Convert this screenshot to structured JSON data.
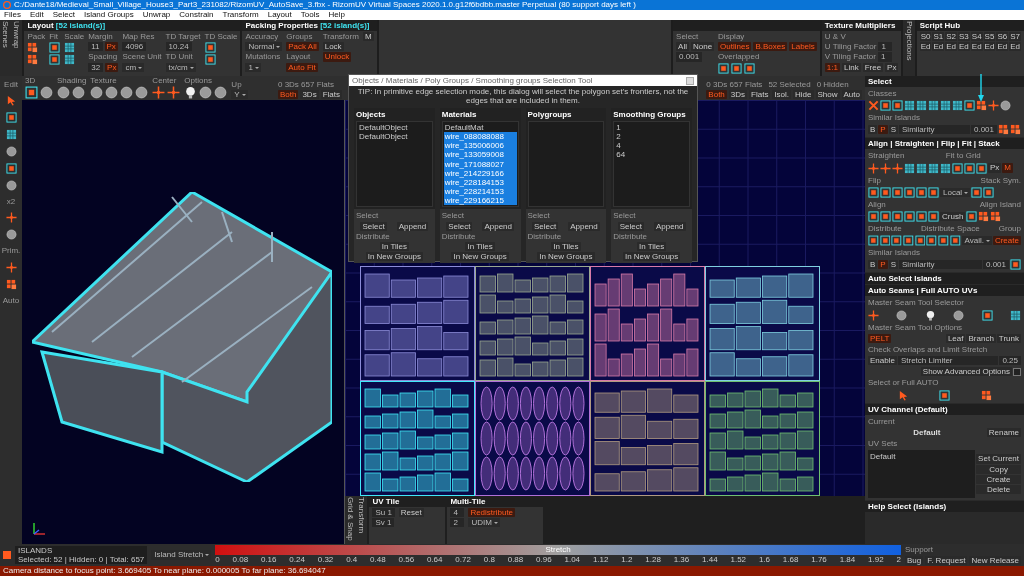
{
  "window": {
    "title": "C:/Dante18/Medieval_Small_Village_House3_Part3_231082/RizomUV_AutoSave_3.fbx - RizomUV  Virtual Spaces 2020.1.0.g12f6bdbb.master Perpetual  (80 support days left )"
  },
  "menu": [
    "Files",
    "Edit",
    "Select",
    "Island Groups",
    "Unwrap",
    "Constrain",
    "Transform",
    "Layout",
    "Tools",
    "Help"
  ],
  "side_tabs": [
    "Scenes",
    "Unwrap"
  ],
  "top_panels": [
    {
      "title": "Layout",
      "highlight": "[52 island(s)]",
      "cols": [
        {
          "items": [
            {
              "kind": "label",
              "text": "Pack"
            },
            {
              "kind": "blocks"
            },
            {
              "kind": "blocks"
            }
          ]
        },
        {
          "items": [
            {
              "kind": "label",
              "text": "Fit"
            },
            {
              "kind": "frame"
            },
            {
              "kind": "frame"
            }
          ]
        },
        {
          "items": [
            {
              "kind": "label",
              "text": "Scale"
            },
            {
              "kind": "grid"
            },
            {
              "kind": "grid"
            }
          ]
        },
        {
          "items": [
            {
              "kind": "label",
              "text": "Margin"
            },
            {
              "kind": "row",
              "items": [
                {
                  "kind": "field",
                  "text": "11"
                },
                {
                  "kind": "button",
                  "text": "Px",
                  "on": true
                }
              ]
            },
            {
              "kind": "label",
              "text": "Spacing"
            },
            {
              "kind": "row",
              "items": [
                {
                  "kind": "field",
                  "text": "32"
                },
                {
                  "kind": "button",
                  "text": "Px",
                  "on": true
                }
              ]
            }
          ]
        },
        {
          "items": [
            {
              "kind": "label",
              "text": "Map Res"
            },
            {
              "kind": "field",
              "text": "4096"
            },
            {
              "kind": "label",
              "text": "Scene Unit"
            },
            {
              "kind": "dropdown",
              "text": "cm"
            }
          ]
        },
        {
          "items": [
            {
              "kind": "label",
              "text": "TD Target"
            },
            {
              "kind": "field",
              "text": "10.24"
            },
            {
              "kind": "label",
              "text": "TD Unit"
            },
            {
              "kind": "dropdown",
              "text": "tx/cm"
            }
          ]
        },
        {
          "items": [
            {
              "kind": "label",
              "text": "TD Scale"
            },
            {
              "kind": "frame"
            },
            {
              "kind": "frame"
            }
          ]
        }
      ]
    },
    {
      "title": "Packing Properties",
      "highlight": "[52 island(s)]",
      "cols": [
        {
          "items": [
            {
              "kind": "label",
              "text": "Accuracy"
            },
            {
              "kind": "dropdown",
              "text": "Normal"
            },
            {
              "kind": "label",
              "text": "Mutations"
            },
            {
              "kind": "dropdown",
              "text": "1"
            }
          ]
        },
        {
          "items": [
            {
              "kind": "label",
              "text": "Groups"
            },
            {
              "kind": "button",
              "text": "Pack All",
              "on": true
            },
            {
              "kind": "label",
              "text": "Layout"
            },
            {
              "kind": "button",
              "text": "Auto Fit",
              "on": true
            }
          ]
        },
        {
          "items": [
            {
              "kind": "label",
              "text": "Transform"
            },
            {
              "kind": "button",
              "text": "Lock",
              "on": false
            },
            {
              "kind": "button",
              "text": "Unlock",
              "on": true
            }
          ]
        },
        {
          "items": [
            {
              "kind": "button",
              "text": "M",
              "on": false
            }
          ]
        }
      ]
    },
    {
      "cols": [
        {
          "items": [
            {
              "kind": "label",
              "text": "Select"
            },
            {
              "kind": "row",
              "items": [
                {
                  "kind": "button",
                  "text": "All",
                  "on": false
                },
                {
                  "kind": "button",
                  "text": "None",
                  "on": false
                }
              ]
            },
            {
              "kind": "field",
              "text": "0.001"
            }
          ]
        },
        {
          "items": [
            {
              "kind": "label",
              "text": "Display"
            },
            {
              "kind": "row",
              "items": [
                {
                  "kind": "button",
                  "text": "Outlines",
                  "on": true
                },
                {
                  "kind": "button",
                  "text": "B.Boxes",
                  "on": true
                },
                {
                  "kind": "button",
                  "text": "Labels",
                  "on": true
                }
              ]
            },
            {
              "kind": "label",
              "text": "Overlapped"
            },
            {
              "kind": "row",
              "items": [
                {
                  "kind": "frame"
                },
                {
                  "kind": "frame"
                },
                {
                  "kind": "frame"
                }
              ]
            }
          ]
        }
      ]
    },
    {
      "title": "Texture Multipliers",
      "cols": [
        {
          "items": [
            {
              "kind": "label",
              "text": "U & V"
            },
            {
              "kind": "row",
              "items": [
                {
                  "kind": "label",
                  "text": "U Tiling Factor"
                },
                {
                  "kind": "field",
                  "text": "1"
                }
              ]
            },
            {
              "kind": "row",
              "items": [
                {
                  "kind": "label",
                  "text": "V Tiling Factor"
                },
                {
                  "kind": "field",
                  "text": "1"
                }
              ]
            },
            {
              "kind": "row",
              "items": [
                {
                  "kind": "button",
                  "text": "1:1",
                  "on": true
                },
                {
                  "kind": "button",
                  "text": "Link",
                  "on": false
                },
                {
                  "kind": "button",
                  "text": "Free",
                  "on": false
                },
                {
                  "kind": "button",
                  "text": "Px",
                  "on": false
                }
              ]
            }
          ]
        }
      ]
    },
    {
      "title": "Script Hub",
      "vtab": "Projections",
      "cols": [
        {
          "items": [
            {
              "kind": "row",
              "items": [
                {
                  "kind": "button",
                  "text": "S0",
                  "on": false
                },
                {
                  "kind": "button",
                  "text": "S1",
                  "on": false
                },
                {
                  "kind": "button",
                  "text": "S2",
                  "on": false
                },
                {
                  "kind": "button",
                  "text": "S3",
                  "on": false
                },
                {
                  "kind": "button",
                  "text": "S4",
                  "on": false
                },
                {
                  "kind": "button",
                  "text": "S5",
                  "on": false
                },
                {
                  "kind": "button",
                  "text": "S6",
                  "on": false
                },
                {
                  "kind": "button",
                  "text": "S7",
                  "on": false
                }
              ]
            },
            {
              "kind": "row",
              "items": [
                {
                  "kind": "button",
                  "text": "Ed",
                  "on": false
                },
                {
                  "kind": "button",
                  "text": "Ed",
                  "on": false
                },
                {
                  "kind": "button",
                  "text": "Ed",
                  "on": false
                },
                {
                  "kind": "button",
                  "text": "Ed",
                  "on": false
                },
                {
                  "kind": "button",
                  "text": "Ed",
                  "on": false
                },
                {
                  "kind": "button",
                  "text": "Ed",
                  "on": false
                },
                {
                  "kind": "button",
                  "text": "Ed",
                  "on": false
                },
                {
                  "kind": "button",
                  "text": "Ed",
                  "on": false
                }
              ]
            }
          ]
        }
      ]
    }
  ],
  "left_strip": [
    {
      "kind": "label",
      "text": "Edit"
    },
    {
      "kind": "pointer"
    },
    {
      "kind": "frame"
    },
    {
      "kind": "grid"
    },
    {
      "kind": "sphere"
    },
    {
      "kind": "frame"
    },
    {
      "kind": "sphere"
    },
    {
      "kind": "label",
      "text": "x2"
    },
    {
      "kind": "cross"
    },
    {
      "kind": "sphere"
    },
    {
      "kind": "label",
      "text": "Prim."
    },
    {
      "kind": "cross"
    },
    {
      "kind": "blocks"
    },
    {
      "kind": "label",
      "text": "Auto"
    }
  ],
  "toolbar": {
    "groups": [
      {
        "label": "3D",
        "items": [
          {
            "kind": "frame"
          },
          {
            "kind": "sphere"
          }
        ]
      },
      {
        "label": "Shading",
        "items": [
          {
            "kind": "sphere"
          },
          {
            "kind": "sphere"
          }
        ]
      },
      {
        "label": "Texture",
        "items": [
          {
            "kind": "sphere"
          },
          {
            "kind": "sphere"
          },
          {
            "kind": "sphere"
          },
          {
            "kind": "sphere"
          }
        ]
      },
      {
        "label": "Center",
        "items": [
          {
            "kind": "cross"
          },
          {
            "kind": "cross"
          }
        ]
      },
      {
        "label": "Options",
        "items": [
          {
            "kind": "bulb"
          },
          {
            "kind": "sphere"
          },
          {
            "kind": "sphere"
          }
        ]
      },
      {
        "label": "Up",
        "items": [
          {
            "kind": "dropdown",
            "text": "Y"
          }
        ]
      }
    ],
    "left_stats": "0 3Ds 657 Flats",
    "left_modes": [
      {
        "text": "Both",
        "selected": true
      },
      {
        "text": "3Ds",
        "selected": false
      },
      {
        "text": "Flats",
        "selected": false
      }
    ],
    "right_stats": [
      "0 3Ds 657 Flats",
      "52 Selected",
      "0 Hidden"
    ],
    "right_modes": [
      {
        "text": "Both",
        "selected": true
      },
      {
        "text": "3Ds",
        "selected": false
      },
      {
        "text": "Flats",
        "selected": false
      },
      {
        "text": "Isol.",
        "selected": false
      },
      {
        "text": "Hide",
        "selected": false
      },
      {
        "text": "Show",
        "selected": false
      },
      {
        "text": "Auto",
        "selected": false
      }
    ]
  },
  "dialog": {
    "title": "Objects / Materials / Poly Groups / Smoothing groups Selection Tool",
    "tip": "TIP: In primitive edge selection mode, this dialog will select the polygon set's frontiers, not the edges that are included in them.",
    "columns": [
      {
        "title": "Objects",
        "items": [
          {
            "text": "DefaultObject",
            "selected": false
          },
          {
            "text": "DefaultObject",
            "selected": false
          }
        ],
        "footer": {
          "select_label": "Select",
          "select_buttons": [
            "Select",
            "Append"
          ],
          "distribute_label": "Distribute",
          "distribute_buttons": [
            "In Tiles",
            "In New Groups"
          ]
        }
      },
      {
        "title": "Materials",
        "items": [
          {
            "text": "DefaultMat",
            "selected": false
          },
          {
            "text": "wire_088088088",
            "selected": true
          },
          {
            "text": "wire_135006006",
            "selected": true
          },
          {
            "text": "wire_133059008",
            "selected": true
          },
          {
            "text": "wire_171088027",
            "selected": true
          },
          {
            "text": "wire_214229166",
            "selected": true
          },
          {
            "text": "wire_228184153",
            "selected": true
          },
          {
            "text": "wire_228214153",
            "selected": true
          },
          {
            "text": "wire_229166215",
            "selected": true
          }
        ],
        "footer": {
          "select_label": "Select",
          "select_buttons": [
            "Select",
            "Append"
          ],
          "distribute_label": "Distribute",
          "distribute_buttons": [
            "In Tiles",
            "In New Groups"
          ]
        }
      },
      {
        "title": "Polygroups",
        "footer": {
          "select_label": "Select",
          "select_buttons": [
            "Select",
            "Append"
          ],
          "distribute_label": "Distribute",
          "distribute_buttons": [
            "In Tiles",
            "In New Groups"
          ]
        }
      },
      {
        "title": "Smoothing Groups",
        "items": [
          {
            "text": "1",
            "selected": false
          },
          {
            "text": "2",
            "selected": false
          },
          {
            "text": "4",
            "selected": false
          },
          {
            "text": "64",
            "selected": false
          }
        ],
        "footer": {
          "select_label": "Select",
          "select_buttons": [
            "Select",
            "Append"
          ],
          "distribute_label": "Distribute",
          "distribute_buttons": [
            "In Tiles",
            "In New Groups"
          ]
        }
      }
    ]
  },
  "uv_tiles": [
    {
      "color": "#8c8cd8"
    },
    {
      "color": "#9aa890"
    },
    {
      "color": "#d87aa8"
    },
    {
      "color": "#7fd0e0"
    },
    {
      "color": "#40e8f8"
    },
    {
      "color": "#b070d8"
    },
    {
      "color": "#b09a80"
    },
    {
      "color": "#70c070"
    }
  ],
  "right_panel": [
    {
      "title": "Select",
      "rows": [
        {
          "items": [
            {
              "kind": "label",
              "text": "Classes"
            }
          ]
        },
        {
          "items": [
            {
              "kind": "xmark"
            },
            {
              "kind": "frame"
            },
            {
              "kind": "frame"
            },
            {
              "kind": "grid"
            },
            {
              "kind": "grid"
            },
            {
              "kind": "grid"
            },
            {
              "kind": "grid"
            },
            {
              "kind": "grid"
            },
            {
              "kind": "frame"
            },
            {
              "kind": "blocks"
            },
            {
              "kind": "cross"
            },
            {
              "kind": "sphere"
            }
          ]
        },
        {
          "items": [
            {
              "kind": "label",
              "text": "Similar Islands"
            }
          ]
        },
        {
          "items": [
            {
              "kind": "button",
              "text": "B",
              "on": false
            },
            {
              "kind": "button",
              "text": "P",
              "on": true
            },
            {
              "kind": "button",
              "text": "S",
              "on": false
            },
            {
              "kind": "wide",
              "text": "Similarity"
            },
            {
              "kind": "field",
              "text": "0.001"
            },
            {
              "kind": "blocks"
            },
            {
              "kind": "blocks"
            }
          ]
        }
      ]
    },
    {
      "title": "Align | Straighten | Flip | Fit | Stack",
      "rows": [
        {
          "items": [
            {
              "kind": "label",
              "text": "Straighten"
            },
            {
              "kind": "spacer"
            },
            {
              "kind": "label",
              "text": "Fit to Grid"
            },
            {
              "kind": "spacer"
            }
          ]
        },
        {
          "items": [
            {
              "kind": "cross"
            },
            {
              "kind": "cross"
            },
            {
              "kind": "cross"
            },
            {
              "kind": "grid"
            },
            {
              "kind": "grid"
            },
            {
              "kind": "grid"
            },
            {
              "kind": "grid"
            },
            {
              "kind": "frame"
            },
            {
              "kind": "frame"
            },
            {
              "kind": "frame"
            },
            {
              "kind": "button",
              "text": "Px",
              "on": false
            },
            {
              "kind": "button",
              "text": "M",
              "on": true
            }
          ]
        },
        {
          "items": [
            {
              "kind": "label",
              "text": "Flip"
            },
            {
              "kind": "spacer"
            },
            {
              "kind": "label",
              "text": "Stack Sym."
            }
          ]
        },
        {
          "items": [
            {
              "kind": "frame"
            },
            {
              "kind": "frame"
            },
            {
              "kind": "frame"
            },
            {
              "kind": "frame"
            },
            {
              "kind": "frame"
            },
            {
              "kind": "frame"
            },
            {
              "kind": "dropdown",
              "text": "Local"
            },
            {
              "kind": "frame"
            },
            {
              "kind": "frame"
            }
          ]
        },
        {
          "items": [
            {
              "kind": "label",
              "text": "Align"
            },
            {
              "kind": "spacer"
            },
            {
              "kind": "label",
              "text": "Align Island"
            }
          ]
        },
        {
          "items": [
            {
              "kind": "frame"
            },
            {
              "kind": "frame"
            },
            {
              "kind": "frame"
            },
            {
              "kind": "frame"
            },
            {
              "kind": "frame"
            },
            {
              "kind": "frame"
            },
            {
              "kind": "button",
              "text": "Crush",
              "on": false
            },
            {
              "kind": "frame"
            },
            {
              "kind": "blocks"
            },
            {
              "kind": "blocks"
            }
          ]
        },
        {
          "items": [
            {
              "kind": "label",
              "text": "Distribute"
            },
            {
              "kind": "spacer"
            },
            {
              "kind": "label",
              "text": "Distribute Space"
            },
            {
              "kind": "spacer"
            },
            {
              "kind": "label",
              "text": "Group"
            }
          ]
        },
        {
          "items": [
            {
              "kind": "frame"
            },
            {
              "kind": "frame"
            },
            {
              "kind": "frame"
            },
            {
              "kind": "frame"
            },
            {
              "kind": "frame"
            },
            {
              "kind": "frame"
            },
            {
              "kind": "frame"
            },
            {
              "kind": "frame"
            },
            {
              "kind": "dropdown",
              "text": "Avail."
            },
            {
              "kind": "button",
              "text": "Create",
              "on": true
            }
          ]
        },
        {
          "items": [
            {
              "kind": "label",
              "text": "Similar Islands"
            }
          ]
        },
        {
          "items": [
            {
              "kind": "button",
              "text": "B",
              "on": false
            },
            {
              "kind": "button",
              "text": "P",
              "on": true
            },
            {
              "kind": "button",
              "text": "S",
              "on": false
            },
            {
              "kind": "wide",
              "text": "Similarity"
            },
            {
              "kind": "field",
              "text": "0.001"
            },
            {
              "kind": "frame"
            }
          ]
        }
      ]
    },
    {
      "title": "Auto Select Islands"
    },
    {
      "title": "Auto Seams | Full AUTO UVs",
      "rows": [
        {
          "items": [
            {
              "kind": "label",
              "text": "Master Seam Tool Selector"
            }
          ]
        },
        {
          "items": [
            {
              "kind": "cross"
            },
            {
              "kind": "spacer"
            },
            {
              "kind": "sphere"
            },
            {
              "kind": "spacer"
            },
            {
              "kind": "bulb"
            },
            {
              "kind": "spacer"
            },
            {
              "kind": "sphere"
            },
            {
              "kind": "spacer"
            },
            {
              "kind": "frame"
            },
            {
              "kind": "spacer"
            },
            {
              "kind": "grid"
            }
          ]
        },
        {
          "items": [
            {
              "kind": "label",
              "text": "Master Seam Tool Options"
            }
          ]
        },
        {
          "items": [
            {
              "kind": "button",
              "text": "PELT",
              "on": true
            },
            {
              "kind": "spacer"
            },
            {
              "kind": "button",
              "text": "Leaf",
              "on": false
            },
            {
              "kind": "button",
              "text": "Branch",
              "on": false
            },
            {
              "kind": "button",
              "text": "Trunk",
              "on": false
            }
          ]
        },
        {
          "items": [
            {
              "kind": "label",
              "text": "Check Overlaps and Limit Stretch"
            }
          ]
        },
        {
          "items": [
            {
              "kind": "button",
              "text": "Enable",
              "on": false
            },
            {
              "kind": "wide",
              "text": "Stretch Limiter"
            },
            {
              "kind": "field",
              "text": "0.25"
            }
          ]
        },
        {
          "items": [
            {
              "kind": "spacer"
            },
            {
              "kind": "button",
              "text": "Show Advanced Options",
              "on": false
            },
            {
              "kind": "check",
              "checked": false
            }
          ]
        },
        {
          "items": [
            {
              "kind": "label",
              "text": "Select or Full AUTO"
            }
          ]
        },
        {
          "items": [
            {
              "kind": "spacer"
            },
            {
              "kind": "pointer"
            },
            {
              "kind": "spacer"
            },
            {
              "kind": "frame"
            },
            {
              "kind": "spacer"
            },
            {
              "kind": "blocks"
            },
            {
              "kind": "spacer"
            }
          ]
        }
      ]
    },
    {
      "title": "UV Channel (Default)",
      "rows": [
        {
          "items": [
            {
              "kind": "label",
              "text": "Current"
            }
          ]
        },
        {
          "items": [
            {
              "kind": "spacer"
            },
            {
              "kind": "strong",
              "text": "Default"
            },
            {
              "kind": "spacer"
            },
            {
              "kind": "button",
              "text": "Rename",
              "on": false
            }
          ]
        },
        {
          "items": [
            {
              "kind": "label",
              "text": "UV Sets"
            }
          ]
        },
        {
          "items": [
            {
              "kind": "list",
              "entries": [
                "Default"
              ]
            },
            {
              "kind": "col",
              "items": [
                {
                  "kind": "button",
                  "text": "Set Current",
                  "on": false
                },
                {
                  "kind": "button",
                  "text": "Copy",
                  "on": false
                },
                {
                  "kind": "button",
                  "text": "Create",
                  "on": false
                },
                {
                  "kind": "button",
                  "text": "Delete",
                  "on": false
                }
              ]
            }
          ]
        }
      ]
    },
    {
      "title": "Help Select (Islands)"
    }
  ],
  "bottom_panels": {
    "side_tabs": [
      "Grid & Snap",
      "Transform"
    ],
    "panels": [
      {
        "title": "UV Tile",
        "cols": [
          {
            "items": [
              {
                "kind": "field",
                "text": "Su 1"
              },
              {
                "kind": "field",
                "text": "Sv 1"
              }
            ]
          },
          {
            "items": [
              {
                "kind": "button",
                "text": "Reset",
                "on": false
              }
            ]
          }
        ]
      },
      {
        "title": "Multi-Tile",
        "cols": [
          {
            "items": [
              {
                "kind": "field",
                "text": "4"
              },
              {
                "kind": "field",
                "text": "2"
              }
            ]
          },
          {
            "items": [
              {
                "kind": "button",
                "text": "Redistribute",
                "on": true
              },
              {
                "kind": "dropdown",
                "text": "UDIM"
              }
            ]
          }
        ]
      }
    ]
  },
  "status": {
    "mode": "ISLANDS",
    "counts": "Selected: 52 | Hidden: 0 | Total: 657",
    "metric": "Island Stretch",
    "scale_label": "Stretch",
    "ticks": [
      "0",
      "0.08",
      "0.16",
      "0.24",
      "0.32",
      "0.4",
      "0.48",
      "0.56",
      "0.64",
      "0.72",
      "0.8",
      "0.88",
      "0.96",
      "1.04",
      "1.12",
      "1.2",
      "1.28",
      "1.36",
      "1.44",
      "1.52",
      "1.6",
      "1.68",
      "1.76",
      "1.84",
      "1.92",
      "2"
    ],
    "support_label": "Support",
    "buttons": [
      "Bug",
      "F. Request",
      "New Release"
    ]
  },
  "footer": "Camera distance to focus point: 3.669405  To near plane: 0.000005  To far plane: 36.694047"
}
